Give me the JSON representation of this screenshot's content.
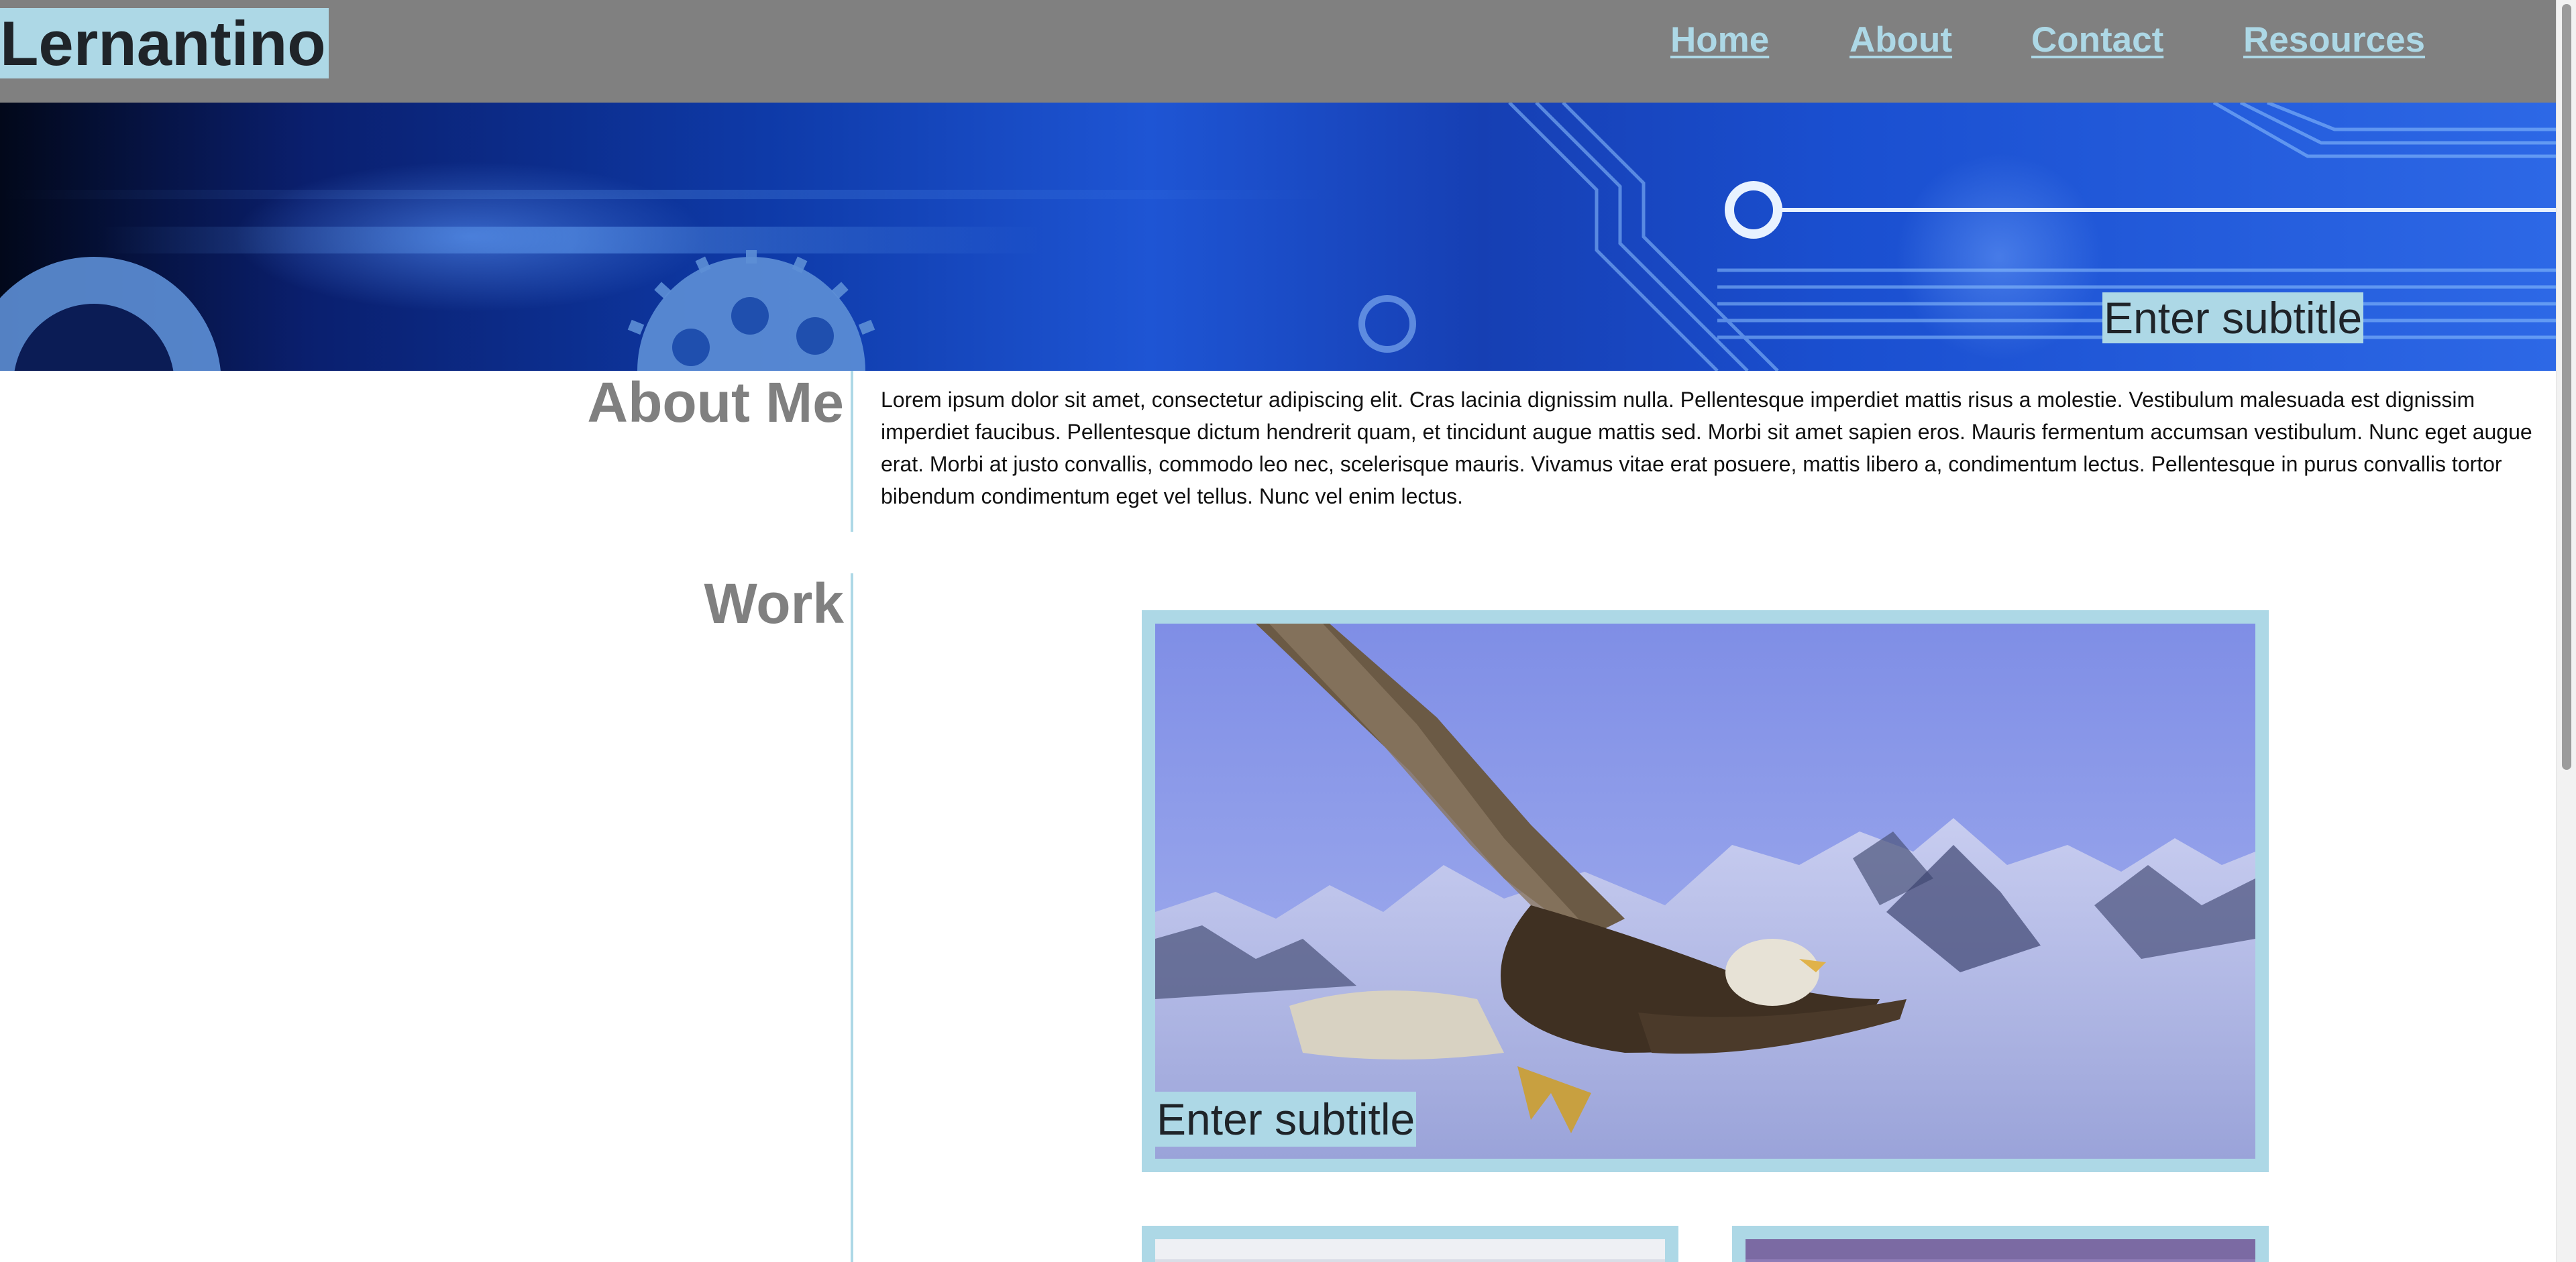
{
  "header": {
    "brand": "Lernantino",
    "nav": [
      {
        "label": "Home"
      },
      {
        "label": "About"
      },
      {
        "label": "Contact"
      },
      {
        "label": "Resources"
      }
    ]
  },
  "banner": {
    "subtitle": "Enter subtitle"
  },
  "about": {
    "heading": "About Me",
    "body": "Lorem ipsum dolor sit amet, consectetur adipiscing elit. Cras lacinia dignissim nulla. Pellentesque imperdiet mattis risus a molestie. Vestibulum malesuada est dignissim imperdiet faucibus. Pellentesque dictum hendrerit quam, et tincidunt augue mattis sed. Morbi sit amet sapien eros. Mauris fermentum accumsan vestibulum. Nunc eget augue erat. Morbi at justo convallis, commodo leo nec, scelerisque mauris. Vivamus vitae erat posuere, mattis libero a, condimentum lectus. Pellentesque in purus convallis tortor bibendum condimentum eget vel tellus. Nunc vel enim lectus."
  },
  "work": {
    "heading": "Work",
    "featured": {
      "caption": "Enter subtitle",
      "image": "eagle-over-mountains"
    },
    "thumbnails": [
      {
        "image": "cloudy-sky"
      },
      {
        "image": "purple-sky"
      }
    ]
  },
  "colors": {
    "header_bg": "#808080",
    "accent": "#add8e6",
    "heading_text": "#808080",
    "dark_text": "#1f2429"
  }
}
